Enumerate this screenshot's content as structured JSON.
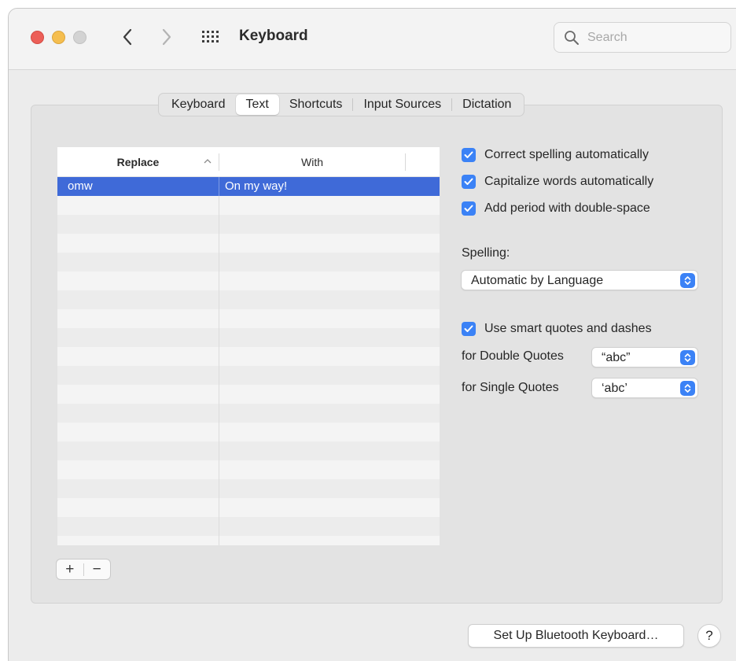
{
  "window": {
    "title": "Keyboard",
    "search_placeholder": "Search"
  },
  "tabs": [
    {
      "label": "Keyboard",
      "selected": false
    },
    {
      "label": "Text",
      "selected": true
    },
    {
      "label": "Shortcuts",
      "selected": false
    },
    {
      "label": "Input Sources",
      "selected": false
    },
    {
      "label": "Dictation",
      "selected": false
    }
  ],
  "table": {
    "col_replace": "Replace",
    "col_with": "With",
    "rows": [
      {
        "replace": "omw",
        "with": "On my way!",
        "selected": true
      }
    ]
  },
  "table_buttons": {
    "add": "+",
    "remove": "−"
  },
  "options": {
    "correct_spelling": {
      "label": "Correct spelling automatically",
      "checked": true
    },
    "capitalize_words": {
      "label": "Capitalize words automatically",
      "checked": true
    },
    "add_period": {
      "label": "Add period with double-space",
      "checked": true
    },
    "spelling_label": "Spelling:",
    "spelling_value": "Automatic by Language",
    "smart_quotes": {
      "label": "Use smart quotes and dashes",
      "checked": true
    },
    "double_quotes_label": "for Double Quotes",
    "double_quotes_value": "“abc”",
    "single_quotes_label": "for Single Quotes",
    "single_quotes_value": "‘abc’"
  },
  "footer": {
    "bluetooth_button": "Set Up Bluetooth Keyboard…",
    "help_button": "?"
  },
  "colors": {
    "accent": "#3b82f6",
    "selection": "#3f6ad8",
    "close": "#ec5f58",
    "minimize": "#f5be4f",
    "zoom_disabled": "#d3d3d3"
  }
}
